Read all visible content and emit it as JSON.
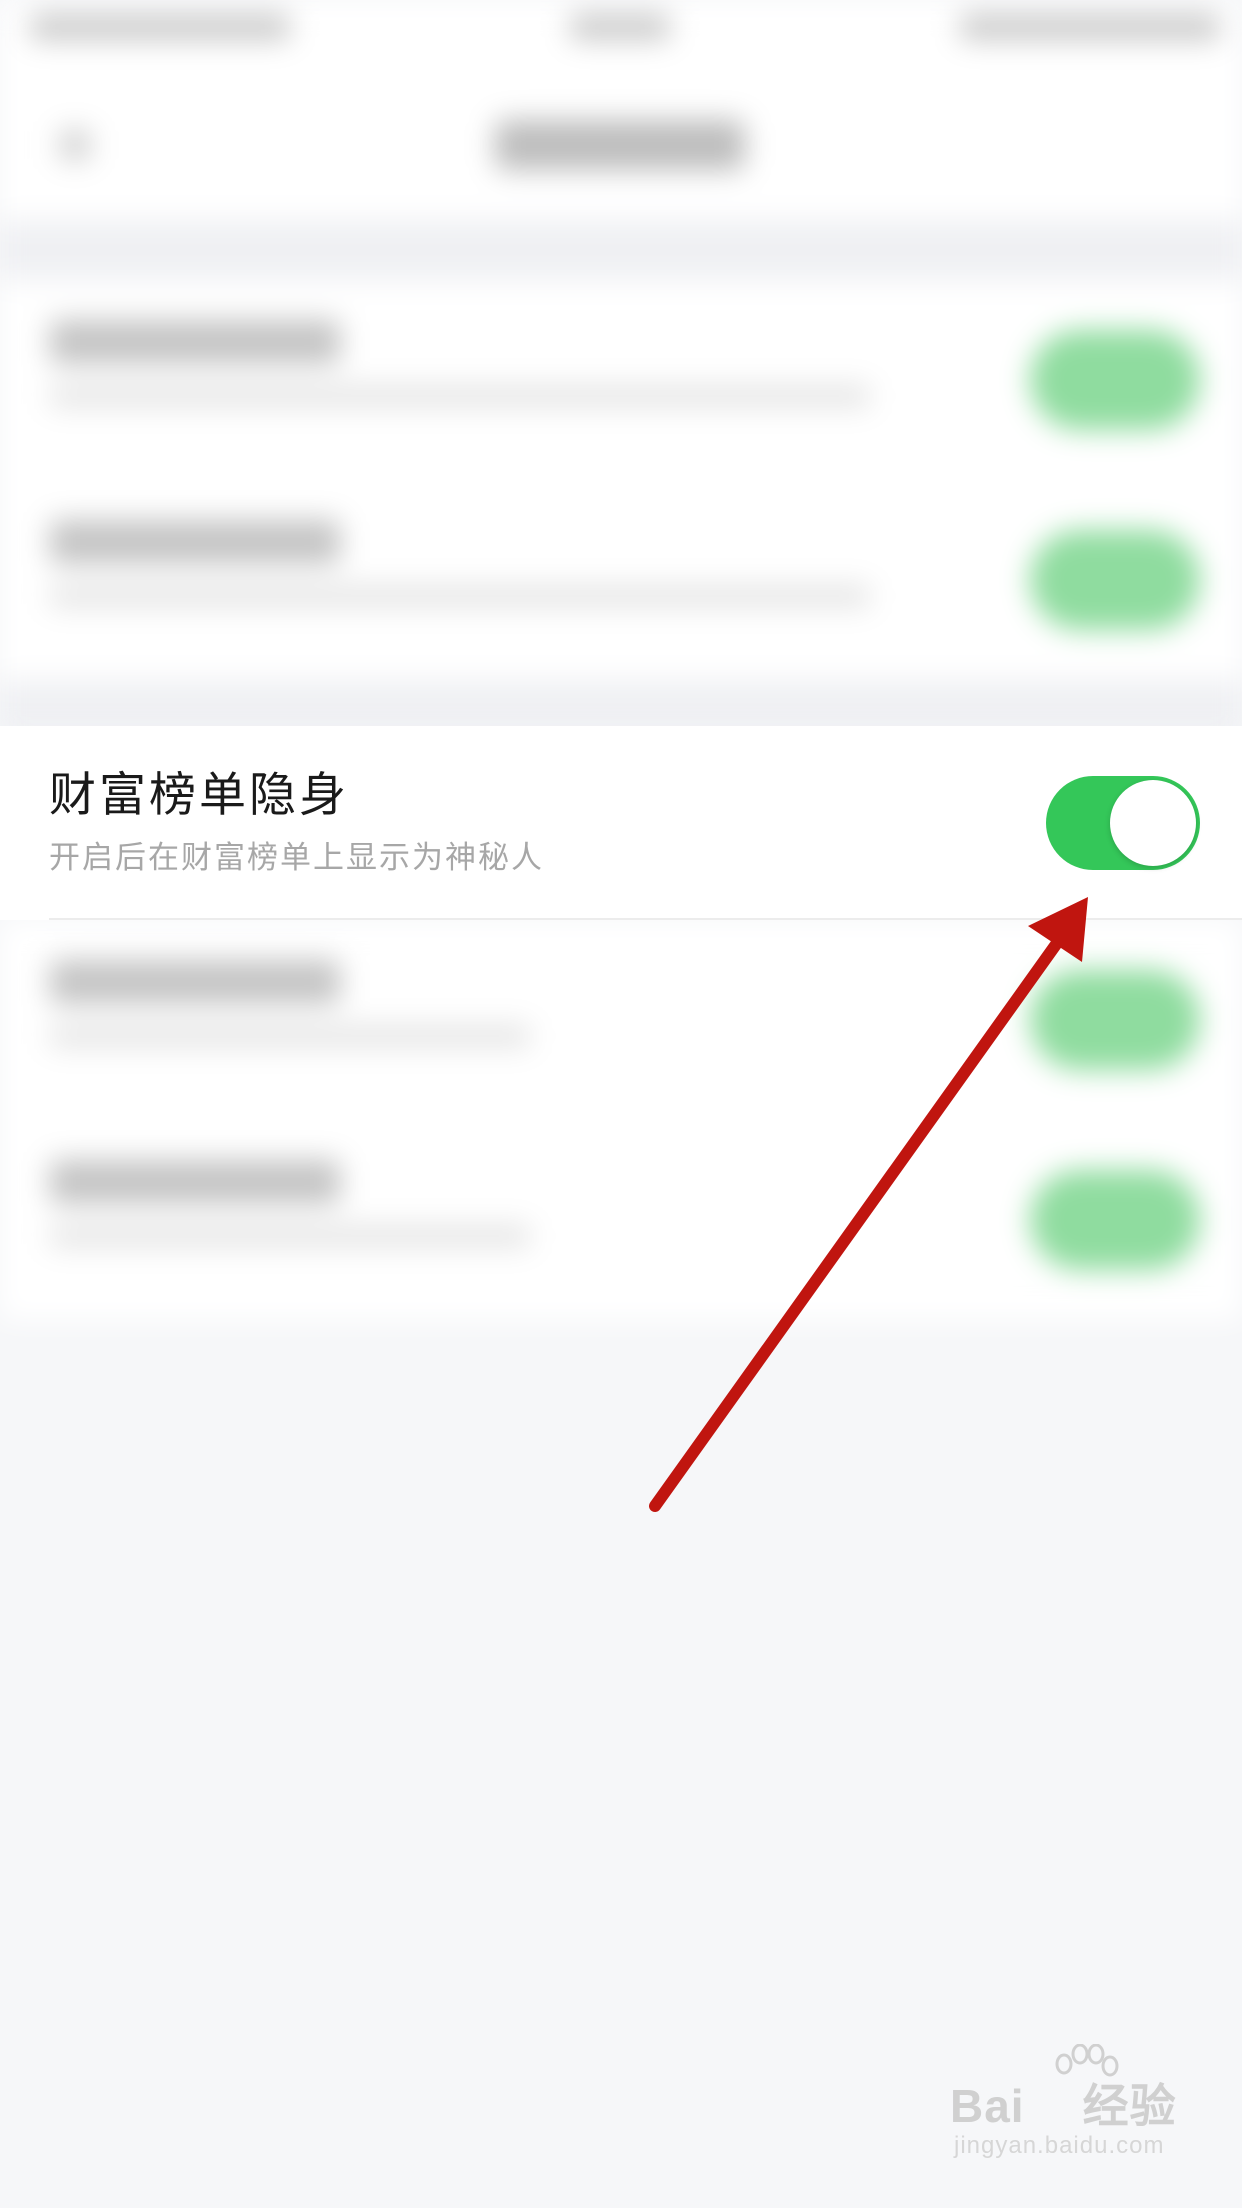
{
  "setting": {
    "title": "财富榜单隐身",
    "subtitle": "开启后在财富榜单上显示为神秘人",
    "enabled": true
  },
  "colors": {
    "toggle_on": "#34c759",
    "arrow": "#c0150f",
    "page_background": "#f6f7f9"
  },
  "watermark": {
    "brand_left": "Bai",
    "brand_right": "经验",
    "url": "jingyan.baidu.com"
  }
}
